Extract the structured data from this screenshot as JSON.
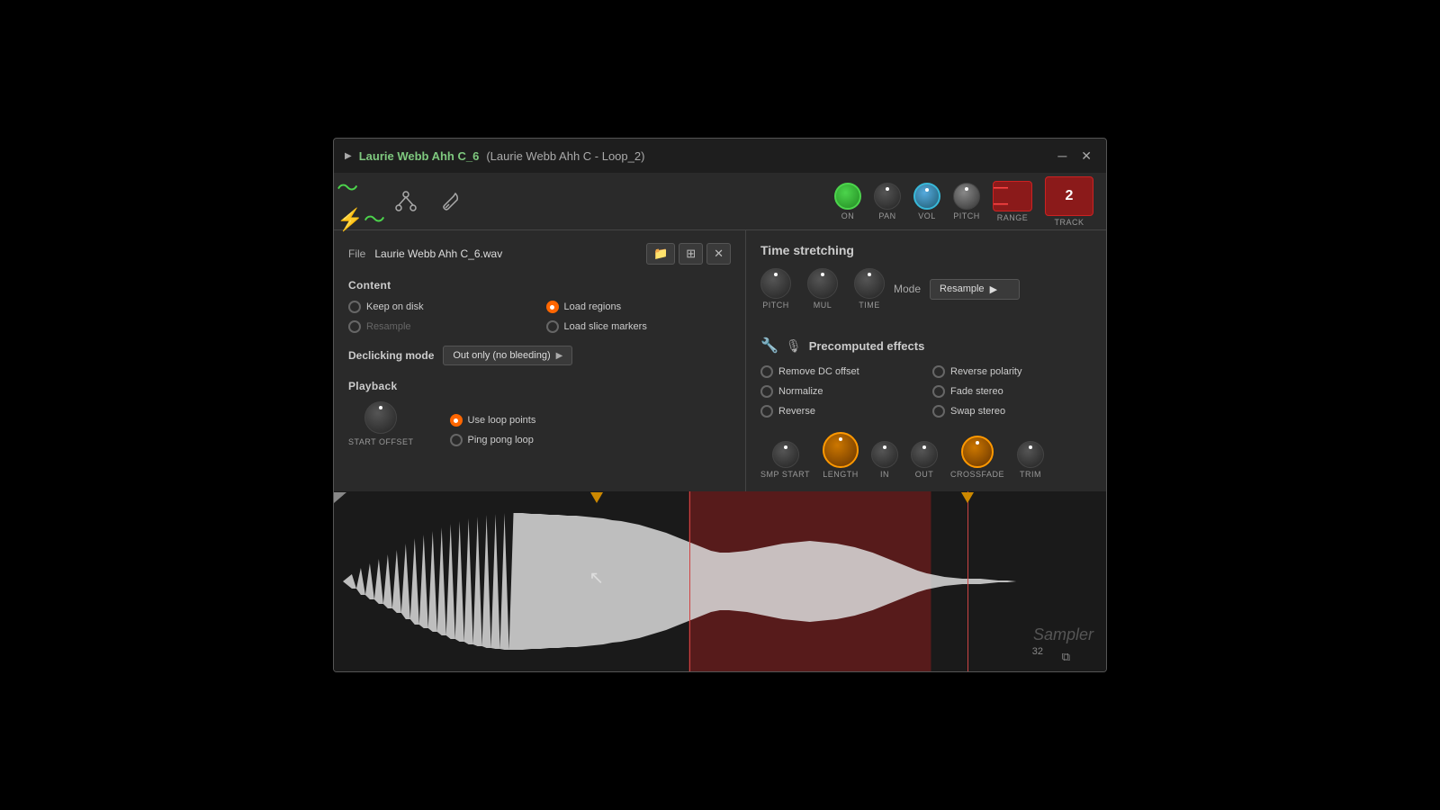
{
  "window": {
    "title_main": "Laurie Webb Ahh C_6",
    "title_sub": " (Laurie Webb Ahh C - Loop_2)",
    "close_btn": "✕",
    "min_btn": "─"
  },
  "toolbar": {
    "on_label": "ON",
    "pan_label": "PAN",
    "vol_label": "VOL",
    "pitch_label": "PITCH",
    "range_label": "RANGE",
    "track_label": "TRACK",
    "track_number": "2",
    "range_symbol": "—  —"
  },
  "file": {
    "label": "File",
    "name": "Laurie Webb Ahh C_6.wav"
  },
  "content": {
    "title": "Content",
    "options": [
      {
        "label": "Keep on disk",
        "active": false
      },
      {
        "label": "Load regions",
        "active": true
      },
      {
        "label": "Resample",
        "active": false,
        "dim": true
      },
      {
        "label": "Load slice markers",
        "active": false
      }
    ]
  },
  "declicking": {
    "label": "Declicking mode",
    "value": "Out only (no bleeding)"
  },
  "playback": {
    "title": "Playback",
    "start_offset_label": "START OFFSET",
    "options": [
      {
        "label": "Use loop points",
        "active": true
      },
      {
        "label": "Ping pong loop",
        "active": false
      }
    ]
  },
  "time_stretching": {
    "title": "Time stretching",
    "knobs": [
      {
        "label": "PITCH"
      },
      {
        "label": "MUL"
      },
      {
        "label": "TIME"
      }
    ],
    "mode_label": "Mode",
    "mode_value": "Resample"
  },
  "precomputed": {
    "title": "Precomputed effects",
    "effects": [
      {
        "label": "Remove DC offset",
        "active": false
      },
      {
        "label": "Reverse polarity",
        "active": false
      },
      {
        "label": "Normalize",
        "active": false
      },
      {
        "label": "Fade stereo",
        "active": false
      },
      {
        "label": "Reverse",
        "active": false
      },
      {
        "label": "Swap stereo",
        "active": false
      }
    ]
  },
  "loop_knobs": [
    {
      "label": "SMP START"
    },
    {
      "label": "LENGTH",
      "large": true
    },
    {
      "label": "IN"
    },
    {
      "label": "OUT"
    },
    {
      "label": "CROSSFADE",
      "medium": true
    },
    {
      "label": "TRIM"
    }
  ],
  "waveform": {
    "sampler_label": "Sampler",
    "num_label": "32"
  }
}
